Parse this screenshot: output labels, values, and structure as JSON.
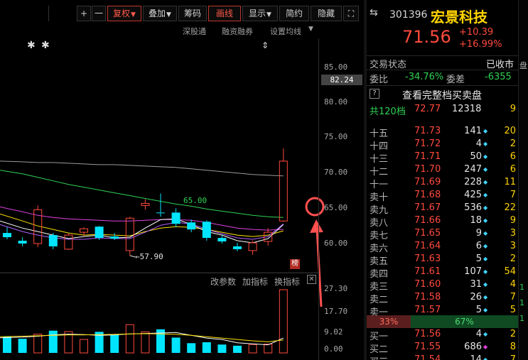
{
  "toolbar": {
    "items": [
      {
        "label": "复权",
        "active": true,
        "caret": true
      },
      {
        "label": "叠加",
        "active": false,
        "caret": true
      },
      {
        "label": "筹码",
        "active": false,
        "caret": false
      },
      {
        "label": "画线",
        "active": true,
        "caret": false
      },
      {
        "label": "显示",
        "active": false,
        "caret": true
      },
      {
        "label": "简约",
        "active": false,
        "caret": false
      },
      {
        "label": "隐藏",
        "active": false,
        "caret": false
      }
    ],
    "plus": "+",
    "minus": "一",
    "expand": "⛶"
  },
  "chart_links": {
    "shenguangtong": "深股通",
    "margin": "融资融券",
    "ma_settings": "设置均线"
  },
  "price_tag": "82.24",
  "ma_label": "65.00",
  "low_label": "←57.90",
  "bang_badge": "榜",
  "indicator_bar": {
    "params": "改参数",
    "add": "加指标",
    "switch": "换指标",
    "close": "✕"
  },
  "stock": {
    "code": "301396",
    "name": "宏景科技",
    "price": "71.56",
    "change": "+10.39",
    "change_pct": "+16.99%"
  },
  "status": {
    "label": "交易状态",
    "value": "已收市"
  },
  "weibi": {
    "label": "委比",
    "value": "-34.76%",
    "diff_label": "委差",
    "diff_value": "-6355"
  },
  "full_book": {
    "q": "?",
    "label": "查看完整档买卖盘"
  },
  "total": {
    "levels": "共120档",
    "price": "72.77",
    "volume": "12318",
    "count": "9"
  },
  "orderbook": [
    {
      "level": "十五",
      "price": "71.73",
      "volume": "141",
      "mark": "◆",
      "count": "20"
    },
    {
      "level": "十四",
      "price": "71.72",
      "volume": "4",
      "mark": "◆",
      "count": "2"
    },
    {
      "level": "十三",
      "price": "71.71",
      "volume": "50",
      "mark": "◆",
      "count": "6"
    },
    {
      "level": "十二",
      "price": "71.70",
      "volume": "247",
      "mark": "◆",
      "count": "6"
    },
    {
      "level": "十一",
      "price": "71.69",
      "volume": "228",
      "mark": "◆",
      "count": "11"
    },
    {
      "level": "卖十",
      "price": "71.68",
      "volume": "425",
      "mark": "◆",
      "count": "7"
    },
    {
      "level": "卖九",
      "price": "71.67",
      "volume": "536",
      "mark": "◆",
      "count": "22"
    },
    {
      "level": "卖八",
      "price": "71.66",
      "volume": "18",
      "mark": "◆",
      "count": "9"
    },
    {
      "level": "卖七",
      "price": "71.65",
      "volume": "9",
      "mark": "◆",
      "count": "3"
    },
    {
      "level": "卖六",
      "price": "71.64",
      "volume": "6",
      "mark": "◆",
      "count": "3"
    },
    {
      "level": "卖五",
      "price": "71.63",
      "volume": "5",
      "mark": "◆",
      "count": "2"
    },
    {
      "level": "卖四",
      "price": "71.61",
      "volume": "107",
      "mark": "◆",
      "count": "54"
    },
    {
      "level": "卖三",
      "price": "71.60",
      "volume": "31",
      "mark": "◆",
      "count": "4"
    },
    {
      "level": "卖二",
      "price": "71.58",
      "volume": "26",
      "mark": "◆",
      "count": "7"
    },
    {
      "level": "卖一",
      "price": "71.57",
      "volume": "5",
      "mark": "◆",
      "count": "5"
    }
  ],
  "ratio": {
    "sell": "33%",
    "buy": "67%"
  },
  "buys": [
    {
      "level": "买一",
      "price": "71.56",
      "volume": "4",
      "mark": "◆",
      "count": "2",
      "magenta": false
    },
    {
      "level": "买二",
      "price": "71.55",
      "volume": "686",
      "mark": "◆",
      "count": "8",
      "magenta": true
    },
    {
      "level": "买三",
      "price": "71.54",
      "volume": "14",
      "mark": "◆",
      "count": "7",
      "magenta": false
    }
  ],
  "colors": {
    "up": "#ff4a3d",
    "down": "#00e5ff",
    "ma5": "#ffffff",
    "ma10": "#ffe100",
    "ma20": "#e040e0",
    "ma60": "#2fd154",
    "ma120": "#9a9a9a"
  },
  "chart_data": {
    "type": "candlestick",
    "price_axis_ticks": [
      "85.00",
      "80.00",
      "75.00",
      "70.00",
      "65.00",
      "60.00"
    ],
    "volume_axis_ticks": [
      "27.30",
      "17.70",
      "9.02",
      "0.00"
    ],
    "ylim": [
      57.0,
      85.0
    ],
    "vol_ylim": [
      0,
      27.3
    ],
    "candles": [
      {
        "o": 61.3,
        "h": 62.1,
        "l": 60.4,
        "c": 60.7
      },
      {
        "o": 60.2,
        "h": 60.7,
        "l": 59.4,
        "c": 59.8
      },
      {
        "o": 59.8,
        "h": 65.2,
        "l": 59.3,
        "c": 64.6
      },
      {
        "o": 61.0,
        "h": 61.3,
        "l": 59.0,
        "c": 59.4
      },
      {
        "o": 59.0,
        "h": 61.2,
        "l": 58.9,
        "c": 61.0
      },
      {
        "o": 61.4,
        "h": 62.1,
        "l": 60.9,
        "c": 61.9
      },
      {
        "o": 62.2,
        "h": 62.3,
        "l": 60.3,
        "c": 60.6
      },
      {
        "o": 60.8,
        "h": 61.3,
        "l": 60.3,
        "c": 60.5
      },
      {
        "o": 58.8,
        "h": 63.6,
        "l": 58.1,
        "c": 63.4
      },
      {
        "o": 65.2,
        "h": 66.1,
        "l": 64.6,
        "c": 65.5
      },
      {
        "o": 64.2,
        "h": 66.9,
        "l": 63.6,
        "c": 64.1
      },
      {
        "o": 64.2,
        "h": 64.8,
        "l": 62.1,
        "c": 62.6
      },
      {
        "o": 62.8,
        "h": 63.2,
        "l": 61.4,
        "c": 61.8
      },
      {
        "o": 62.9,
        "h": 63.1,
        "l": 60.2,
        "c": 60.6
      },
      {
        "o": 60.6,
        "h": 61.0,
        "l": 59.8,
        "c": 60.1
      },
      {
        "o": 59.4,
        "h": 59.9,
        "l": 58.7,
        "c": 59.0
      },
      {
        "o": 58.8,
        "h": 60.2,
        "l": 58.2,
        "c": 59.9
      },
      {
        "o": 60.1,
        "h": 62.0,
        "l": 59.5,
        "c": 61.4
      },
      {
        "o": 63.0,
        "h": 73.3,
        "l": 62.9,
        "c": 71.5
      }
    ],
    "volumes": [
      {
        "v": 7.1,
        "up": false
      },
      {
        "v": 6.1,
        "up": false
      },
      {
        "v": 8.1,
        "up": true
      },
      {
        "v": 9.6,
        "up": false
      },
      {
        "v": 9.2,
        "up": true
      },
      {
        "v": 5.8,
        "up": true
      },
      {
        "v": 9.1,
        "up": false
      },
      {
        "v": 7.8,
        "up": false
      },
      {
        "v": 12.2,
        "up": true
      },
      {
        "v": 9.1,
        "up": true
      },
      {
        "v": 10.2,
        "up": false
      },
      {
        "v": 6.6,
        "up": false
      },
      {
        "v": 4.2,
        "up": false
      },
      {
        "v": 4.6,
        "up": false
      },
      {
        "v": 3.6,
        "up": false
      },
      {
        "v": 3.1,
        "up": false
      },
      {
        "v": 3.6,
        "up": true
      },
      {
        "v": 3.8,
        "up": true
      },
      {
        "v": 27.3,
        "up": true
      }
    ],
    "ma_lines": [
      {
        "key": "ma120",
        "values": [
          71.5,
          71.4,
          71.3,
          71.3,
          71.2,
          71.1,
          71.0,
          71.0,
          70.9,
          70.8,
          70.7,
          70.6,
          70.4,
          70.2,
          70.0,
          69.8,
          69.6,
          69.5,
          69.4
        ]
      },
      {
        "key": "ma60",
        "values": [
          70.2,
          69.7,
          69.2,
          68.7,
          68.2,
          67.8,
          67.4,
          67.0,
          66.6,
          66.2,
          65.8,
          65.4,
          65.1,
          64.7,
          64.4,
          64.1,
          63.8,
          63.6,
          63.5
        ]
      },
      {
        "key": "ma20",
        "values": [
          65.0,
          64.3,
          63.8,
          63.5,
          63.3,
          63.2,
          63.1,
          63.0,
          63.0,
          63.1,
          63.2,
          63.2,
          63.1,
          62.8,
          62.4,
          62.0,
          61.8,
          61.7,
          61.8
        ]
      },
      {
        "key": "ma10",
        "values": [
          64.0,
          63.0,
          62.3,
          61.8,
          61.3,
          61.0,
          61.1,
          61.0,
          60.9,
          61.5,
          62.0,
          62.2,
          62.1,
          61.8,
          61.4,
          61.0,
          60.8,
          61.0,
          61.6
        ]
      },
      {
        "key": "ma5",
        "values": [
          63.0,
          62.0,
          61.5,
          61.0,
          60.5,
          60.8,
          61.0,
          60.6,
          60.7,
          62.0,
          63.2,
          63.3,
          62.5,
          61.5,
          61.0,
          60.2,
          59.9,
          60.5,
          62.5
        ]
      },
      {
        "key": "ma_alt",
        "values": [
          62.5,
          61.5,
          61.0,
          60.6,
          60.4,
          60.4,
          60.6,
          60.5,
          60.5,
          61.4,
          62.4,
          62.8,
          62.6,
          61.8,
          61.2,
          60.6,
          60.4,
          60.8,
          62.6
        ]
      }
    ],
    "vol_ma_lines": [
      {
        "key": "ma5",
        "values": [
          6.5,
          6.8,
          7.2,
          7.8,
          8.1,
          7.9,
          7.6,
          7.8,
          8.2,
          8.4,
          8.6,
          8.8,
          7.6,
          6.4,
          5.8,
          4.4,
          3.9,
          3.5,
          6.4
        ]
      },
      {
        "key": "ma10",
        "values": [
          7.0,
          7.2,
          7.4,
          7.6,
          7.8,
          7.8,
          7.9,
          8.0,
          8.2,
          8.3,
          8.2,
          8.0,
          7.6,
          7.0,
          6.4,
          5.8,
          5.2,
          4.8,
          5.6
        ]
      }
    ]
  }
}
